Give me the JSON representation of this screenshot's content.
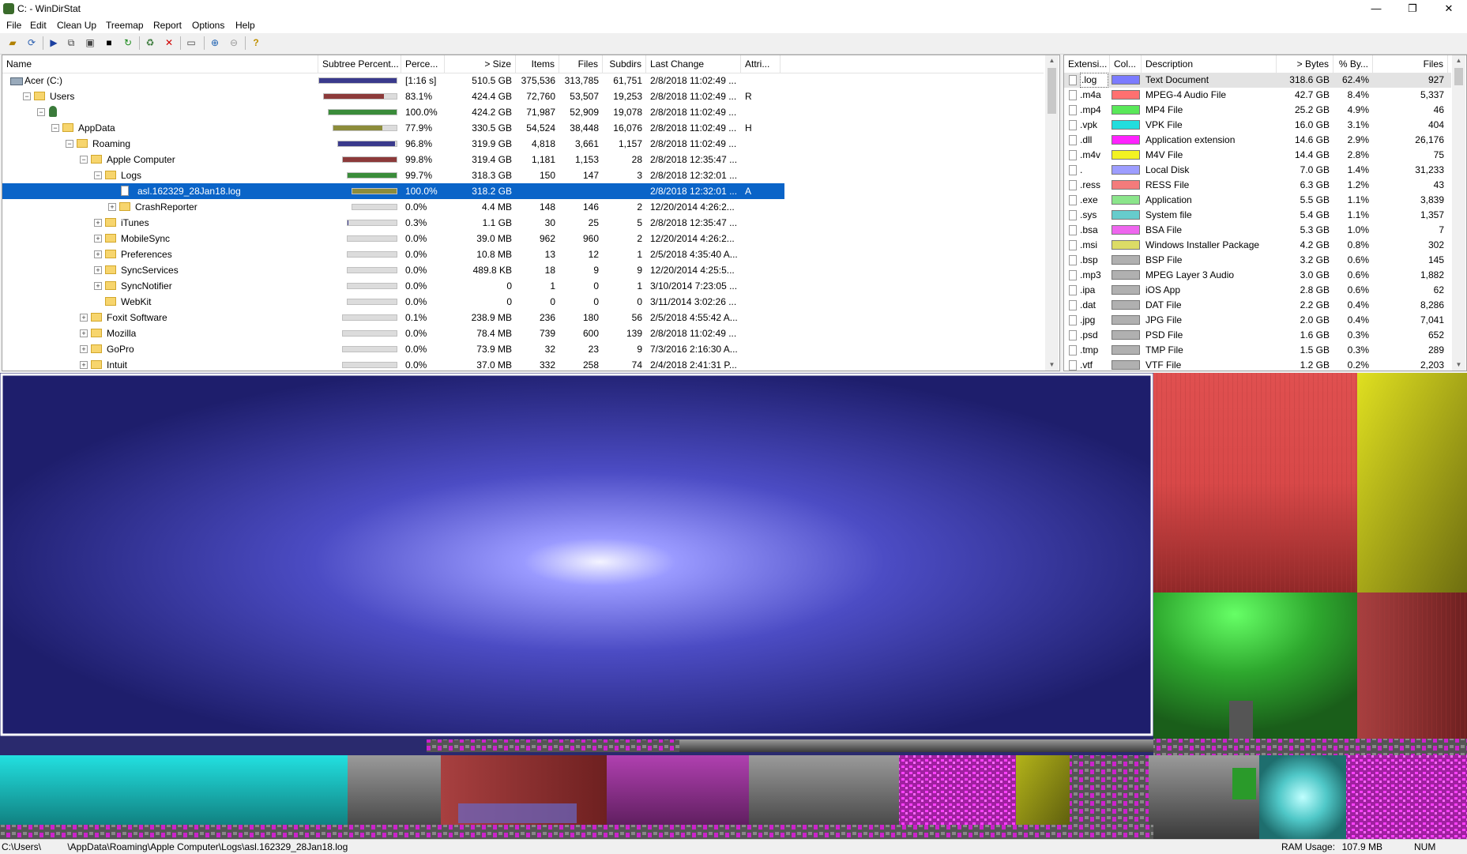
{
  "window": {
    "title": "C: - WinDirStat",
    "minimize": "—",
    "maximize": "❐",
    "close": "✕"
  },
  "menu": [
    "File",
    "Edit",
    "Clean Up",
    "Treemap",
    "Report",
    "Options",
    "Help"
  ],
  "tree_headers": {
    "name": "Name",
    "subtree": "Subtree Percent...",
    "perc": "Perce...",
    "size": "> Size",
    "items": "Items",
    "files": "Files",
    "subdirs": "Subdirs",
    "lastchange": "Last Change",
    "attr": "Attri..."
  },
  "tree_rows": [
    {
      "name": "Acer (C:)",
      "level": 0,
      "toggle": "",
      "icon": "drive",
      "bar": 1.0,
      "bar_color": "#3a3a8c",
      "perc": "[1:16 s]",
      "size": "510.5 GB",
      "items": "375,536",
      "files": "313,785",
      "subdirs": "61,751",
      "last": "2/8/2018  11:02:49 ...",
      "attr": ""
    },
    {
      "name": "Users",
      "level": 1,
      "toggle": "−",
      "icon": "folder",
      "bar": 0.831,
      "bar_color": "#8c3a3a",
      "perc": "83.1%",
      "size": "424.4 GB",
      "items": "72,760",
      "files": "53,507",
      "subdirs": "19,253",
      "last": "2/8/2018  11:02:49 ...",
      "attr": "R"
    },
    {
      "name": "",
      "level": 2,
      "toggle": "−",
      "icon": "user",
      "bar": 1.0,
      "bar_color": "#3a8c3a",
      "perc": "100.0%",
      "size": "424.2 GB",
      "items": "71,987",
      "files": "52,909",
      "subdirs": "19,078",
      "last": "2/8/2018  11:02:49 ...",
      "attr": ""
    },
    {
      "name": "AppData",
      "level": 3,
      "toggle": "−",
      "icon": "folder",
      "bar": 0.779,
      "bar_color": "#8c8c3a",
      "perc": "77.9%",
      "size": "330.5 GB",
      "items": "54,524",
      "files": "38,448",
      "subdirs": "16,076",
      "last": "2/8/2018  11:02:49 ...",
      "attr": "H"
    },
    {
      "name": "Roaming",
      "level": 4,
      "toggle": "−",
      "icon": "folder",
      "bar": 0.968,
      "bar_color": "#3a3a8c",
      "perc": "96.8%",
      "size": "319.9 GB",
      "items": "4,818",
      "files": "3,661",
      "subdirs": "1,157",
      "last": "2/8/2018  11:02:49 ...",
      "attr": ""
    },
    {
      "name": "Apple Computer",
      "level": 5,
      "toggle": "−",
      "icon": "folder",
      "bar": 0.998,
      "bar_color": "#8c3a3a",
      "perc": "99.8%",
      "size": "319.4 GB",
      "items": "1,181",
      "files": "1,153",
      "subdirs": "28",
      "last": "2/8/2018  12:35:47 ...",
      "attr": ""
    },
    {
      "name": "Logs",
      "level": 6,
      "toggle": "−",
      "icon": "folder",
      "bar": 0.997,
      "bar_color": "#3a8c3a",
      "perc": "99.7%",
      "size": "318.3 GB",
      "items": "150",
      "files": "147",
      "subdirs": "3",
      "last": "2/8/2018  12:32:01 ...",
      "attr": ""
    },
    {
      "name": "asl.162329_28Jan18.log",
      "level": 7,
      "toggle": "",
      "icon": "file",
      "bar": 1.0,
      "bar_color": "#8c8c3a",
      "perc": "100.0%",
      "size": "318.2 GB",
      "items": "",
      "files": "",
      "subdirs": "",
      "last": "2/8/2018  12:32:01 ...",
      "attr": "A",
      "selected": true
    },
    {
      "name": "CrashReporter",
      "level": 7,
      "toggle": "+",
      "icon": "folder",
      "bar": 0.0,
      "bar_color": "#3a3a8c",
      "perc": "0.0%",
      "size": "4.4 MB",
      "items": "148",
      "files": "146",
      "subdirs": "2",
      "last": "12/20/2014  4:26:2...",
      "attr": ""
    },
    {
      "name": "iTunes",
      "level": 6,
      "toggle": "+",
      "icon": "folder",
      "bar": 0.003,
      "bar_color": "#3a3a8c",
      "perc": "0.3%",
      "size": "1.1 GB",
      "items": "30",
      "files": "25",
      "subdirs": "5",
      "last": "2/8/2018  12:35:47 ...",
      "attr": ""
    },
    {
      "name": "MobileSync",
      "level": 6,
      "toggle": "+",
      "icon": "folder",
      "bar": 0.0,
      "bar_color": "#3a3a8c",
      "perc": "0.0%",
      "size": "39.0 MB",
      "items": "962",
      "files": "960",
      "subdirs": "2",
      "last": "12/20/2014  4:26:2...",
      "attr": ""
    },
    {
      "name": "Preferences",
      "level": 6,
      "toggle": "+",
      "icon": "folder",
      "bar": 0.0,
      "bar_color": "#3a3a8c",
      "perc": "0.0%",
      "size": "10.8 MB",
      "items": "13",
      "files": "12",
      "subdirs": "1",
      "last": "2/5/2018  4:35:40 A...",
      "attr": ""
    },
    {
      "name": "SyncServices",
      "level": 6,
      "toggle": "+",
      "icon": "folder",
      "bar": 0.0,
      "bar_color": "#3a3a8c",
      "perc": "0.0%",
      "size": "489.8 KB",
      "items": "18",
      "files": "9",
      "subdirs": "9",
      "last": "12/20/2014  4:25:5...",
      "attr": ""
    },
    {
      "name": "SyncNotifier",
      "level": 6,
      "toggle": "+",
      "icon": "folder",
      "bar": 0.0,
      "bar_color": "#3a3a8c",
      "perc": "0.0%",
      "size": "0",
      "items": "1",
      "files": "0",
      "subdirs": "1",
      "last": "3/10/2014  7:23:05 ...",
      "attr": ""
    },
    {
      "name": "WebKit",
      "level": 6,
      "toggle": "",
      "icon": "folder",
      "bar": 0.0,
      "bar_color": "#3a3a8c",
      "perc": "0.0%",
      "size": "0",
      "items": "0",
      "files": "0",
      "subdirs": "0",
      "last": "3/11/2014  3:02:26 ...",
      "attr": ""
    },
    {
      "name": "Foxit Software",
      "level": 5,
      "toggle": "+",
      "icon": "folder",
      "bar": 0.001,
      "bar_color": "#3a3a8c",
      "perc": "0.1%",
      "size": "238.9 MB",
      "items": "236",
      "files": "180",
      "subdirs": "56",
      "last": "2/5/2018  4:55:42 A...",
      "attr": ""
    },
    {
      "name": "Mozilla",
      "level": 5,
      "toggle": "+",
      "icon": "folder",
      "bar": 0.0,
      "bar_color": "#3a3a8c",
      "perc": "0.0%",
      "size": "78.4 MB",
      "items": "739",
      "files": "600",
      "subdirs": "139",
      "last": "2/8/2018  11:02:49 ...",
      "attr": ""
    },
    {
      "name": "GoPro",
      "level": 5,
      "toggle": "+",
      "icon": "folder",
      "bar": 0.0,
      "bar_color": "#3a3a8c",
      "perc": "0.0%",
      "size": "73.9 MB",
      "items": "32",
      "files": "23",
      "subdirs": "9",
      "last": "7/3/2016  2:16:30 A...",
      "attr": ""
    },
    {
      "name": "Intuit",
      "level": 5,
      "toggle": "+",
      "icon": "folder",
      "bar": 0.0,
      "bar_color": "#3a3a8c",
      "perc": "0.0%",
      "size": "37.0 MB",
      "items": "332",
      "files": "258",
      "subdirs": "74",
      "last": "2/4/2018  2:41:31 P...",
      "attr": ""
    }
  ],
  "ext_headers": {
    "ext": "Extensi...",
    "color": "Col...",
    "desc": "Description",
    "bytes": "> Bytes",
    "pct": "% By...",
    "files": "Files"
  },
  "ext_rows": [
    {
      "ext": ".log",
      "color": "#7b7bff",
      "desc": "Text Document",
      "bytes": "318.6 GB",
      "pct": "62.4%",
      "files": "927",
      "selected": true
    },
    {
      "ext": ".m4a",
      "color": "#ff7070",
      "desc": "MPEG-4 Audio File",
      "bytes": "42.7 GB",
      "pct": "8.4%",
      "files": "5,337"
    },
    {
      "ext": ".mp4",
      "color": "#59e859",
      "desc": "MP4 File",
      "bytes": "25.2 GB",
      "pct": "4.9%",
      "files": "46"
    },
    {
      "ext": ".vpk",
      "color": "#22dddd",
      "desc": "VPK File",
      "bytes": "16.0 GB",
      "pct": "3.1%",
      "files": "404"
    },
    {
      "ext": ".dll",
      "color": "#ff22ff",
      "desc": "Application extension",
      "bytes": "14.6 GB",
      "pct": "2.9%",
      "files": "26,176"
    },
    {
      "ext": ".m4v",
      "color": "#f2f222",
      "desc": "M4V File",
      "bytes": "14.4 GB",
      "pct": "2.8%",
      "files": "75"
    },
    {
      "ext": ".",
      "color": "#9d9dff",
      "desc": "Local Disk",
      "bytes": "7.0 GB",
      "pct": "1.4%",
      "files": "31,233"
    },
    {
      "ext": ".ress",
      "color": "#f37b7b",
      "desc": "RESS File",
      "bytes": "6.3 GB",
      "pct": "1.2%",
      "files": "43"
    },
    {
      "ext": ".exe",
      "color": "#8be58b",
      "desc": "Application",
      "bytes": "5.5 GB",
      "pct": "1.1%",
      "files": "3,839"
    },
    {
      "ext": ".sys",
      "color": "#66cccc",
      "desc": "System file",
      "bytes": "5.4 GB",
      "pct": "1.1%",
      "files": "1,357"
    },
    {
      "ext": ".bsa",
      "color": "#ee66ee",
      "desc": "BSA File",
      "bytes": "5.3 GB",
      "pct": "1.0%",
      "files": "7"
    },
    {
      "ext": ".msi",
      "color": "#dcdc66",
      "desc": "Windows Installer Package",
      "bytes": "4.2 GB",
      "pct": "0.8%",
      "files": "302"
    },
    {
      "ext": ".bsp",
      "color": "#b0b0b0",
      "desc": "BSP File",
      "bytes": "3.2 GB",
      "pct": "0.6%",
      "files": "145"
    },
    {
      "ext": ".mp3",
      "color": "#b0b0b0",
      "desc": "MPEG Layer 3 Audio",
      "bytes": "3.0 GB",
      "pct": "0.6%",
      "files": "1,882"
    },
    {
      "ext": ".ipa",
      "color": "#b0b0b0",
      "desc": "iOS App",
      "bytes": "2.8 GB",
      "pct": "0.6%",
      "files": "62"
    },
    {
      "ext": ".dat",
      "color": "#b0b0b0",
      "desc": "DAT File",
      "bytes": "2.2 GB",
      "pct": "0.4%",
      "files": "8,286"
    },
    {
      "ext": ".jpg",
      "color": "#b0b0b0",
      "desc": "JPG File",
      "bytes": "2.0 GB",
      "pct": "0.4%",
      "files": "7,041"
    },
    {
      "ext": ".psd",
      "color": "#b0b0b0",
      "desc": "PSD File",
      "bytes": "1.6 GB",
      "pct": "0.3%",
      "files": "652"
    },
    {
      "ext": ".tmp",
      "color": "#b0b0b0",
      "desc": "TMP File",
      "bytes": "1.5 GB",
      "pct": "0.3%",
      "files": "289"
    },
    {
      "ext": ".vtf",
      "color": "#b0b0b0",
      "desc": "VTF File",
      "bytes": "1.2 GB",
      "pct": "0.2%",
      "files": "2,203"
    }
  ],
  "status": {
    "path": "C:\\Users\\          \\AppData\\Roaming\\Apple Computer\\Logs\\asl.162329_28Jan18.log",
    "ram_label": "RAM Usage:",
    "ram_value": "107.9 MB",
    "num": "NUM"
  },
  "colors": {
    "selection": "#0a64c8",
    "treemap_highlight": "#ffffff"
  }
}
